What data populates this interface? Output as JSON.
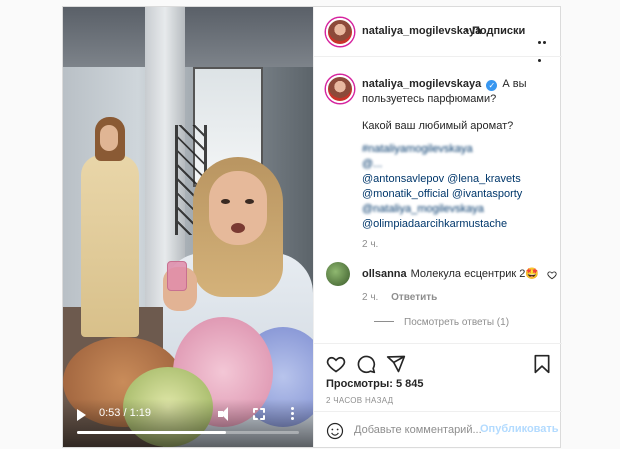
{
  "post": {
    "username": "nataliya_mogilevskaya",
    "follow_label": "Подписки",
    "caption_intro": "А вы пользуетесь парфюмами?",
    "caption_question": "Какой ваш любимый аромат?",
    "mentions": [
      "#nataliyamogilevskaya",
      "@...",
      "@antonsavlepov @lena_kravets",
      "@monatik_official @ivantasporty",
      "@nataliya_mogilevskaya",
      "@olimpiadaarcihkarmustache"
    ],
    "caption_time": "2 ч."
  },
  "video": {
    "current_time": "0:53",
    "separator": "/",
    "duration": "1:19",
    "progress_fraction": 0.67
  },
  "comment": {
    "username": "ollsanna",
    "text": "Молекула есцентрик 2🤩",
    "time": "2 ч.",
    "reply_label": "Ответить",
    "view_replies": "Посмотреть ответы (1)"
  },
  "stats": {
    "views": "Просмотры: 5 845",
    "post_time": "2 ЧАСОВ НАЗАД"
  },
  "comment_box": {
    "placeholder": "Добавьте комментарий...",
    "publish_label": "Опубликовать"
  },
  "colors": {
    "link": "#00376b",
    "publish_disabled": "#b3dbff",
    "verified": "#3897f0"
  },
  "icons": [
    "play-icon",
    "volume-icon",
    "fullscreen-icon",
    "more-vertical-icon",
    "more-horizontal-icon",
    "verified-icon",
    "heart-icon",
    "comment-icon",
    "share-icon",
    "bookmark-icon",
    "emoji-icon"
  ]
}
